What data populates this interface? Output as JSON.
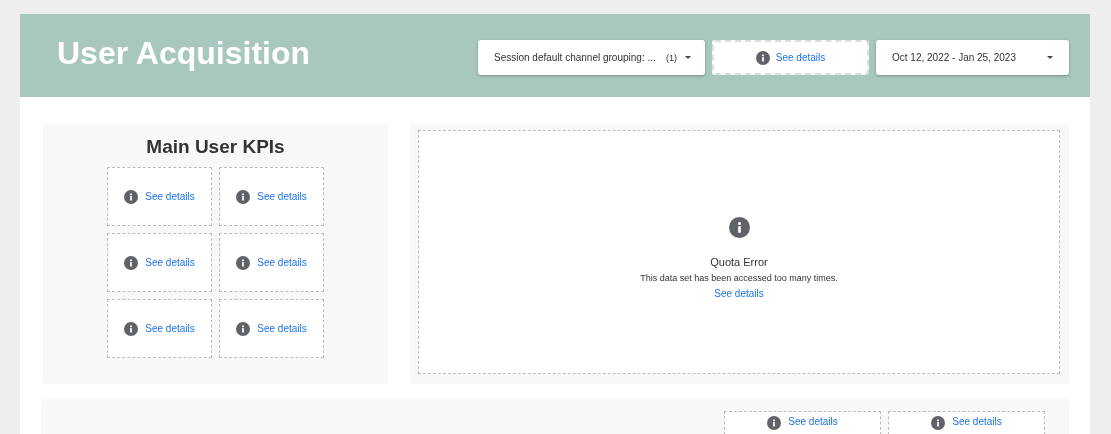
{
  "header": {
    "title": "User Acquisition",
    "filter": {
      "label": "Session default channel grouping: ...",
      "count": "(1)"
    },
    "filter_error": {
      "link": "See details"
    },
    "date_range": {
      "label": "Oct 12, 2022 - Jan 25, 2023"
    }
  },
  "kpi_panel": {
    "title": "Main User KPIs",
    "tiles": [
      {
        "link": "See details"
      },
      {
        "link": "See details"
      },
      {
        "link": "See details"
      },
      {
        "link": "See details"
      },
      {
        "link": "See details"
      },
      {
        "link": "See details"
      }
    ]
  },
  "chart_panel": {
    "error_title": "Quota Error",
    "error_message": "This data set has been accessed too many times.",
    "link": "See details"
  },
  "bottom_panel": {
    "tiles": [
      {
        "link": "See details"
      },
      {
        "link": "See details"
      }
    ]
  }
}
